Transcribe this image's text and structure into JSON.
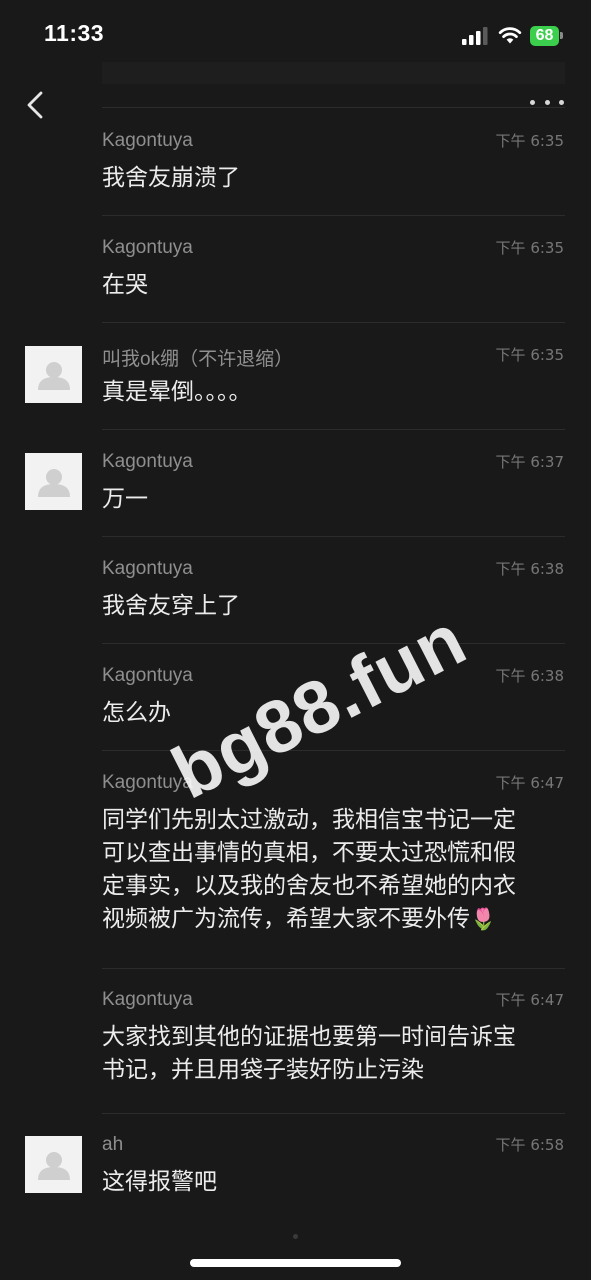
{
  "status_bar": {
    "time": "11:33",
    "battery": "68"
  },
  "messages": [
    {
      "sender": "Kagontuya",
      "time": "下午 6:35",
      "text": "我舍友崩溃了",
      "avatar": false
    },
    {
      "sender": "Kagontuya",
      "time": "下午 6:35",
      "text": "在哭",
      "avatar": false
    },
    {
      "sender": "叫我ok绷（不许退缩）",
      "time": "下午 6:35",
      "text": "真是晕倒。。。。",
      "avatar": true
    },
    {
      "sender": "Kagontuya",
      "time": "下午 6:37",
      "text": "万一",
      "avatar": true
    },
    {
      "sender": "Kagontuya",
      "time": "下午 6:38",
      "text": "我舍友穿上了",
      "avatar": false
    },
    {
      "sender": "Kagontuya",
      "time": "下午 6:38",
      "text": "怎么办",
      "avatar": false
    },
    {
      "sender": "Kagontuya",
      "time": "下午 6:47",
      "text": "同学们先别太过激动，我相信宝书记一定\n可以查出事情的真相，不要太过恐慌和假\n定事实，以及我的舍友也不希望她的内衣\n视频被广为流传，希望大家不要外传",
      "emoji": "🌷",
      "avatar": false
    },
    {
      "sender": "Kagontuya",
      "time": "下午 6:47",
      "text": "大家找到其他的证据也要第一时间告诉宝\n书记，并且用袋子装好防止污染",
      "avatar": false
    },
    {
      "sender": "ah",
      "time": "下午 6:58",
      "text": "这得报警吧",
      "avatar": true
    }
  ],
  "watermark": "bg88.fun",
  "colors": {
    "background": "#191919",
    "battery": "#3ccf4e",
    "sender": "#8f8f8f",
    "time": "#777777",
    "text": "#ececec"
  },
  "icons": {
    "back": "chevron-left-icon",
    "more": "ellipsis-icon",
    "avatar": "default-user-icon"
  }
}
